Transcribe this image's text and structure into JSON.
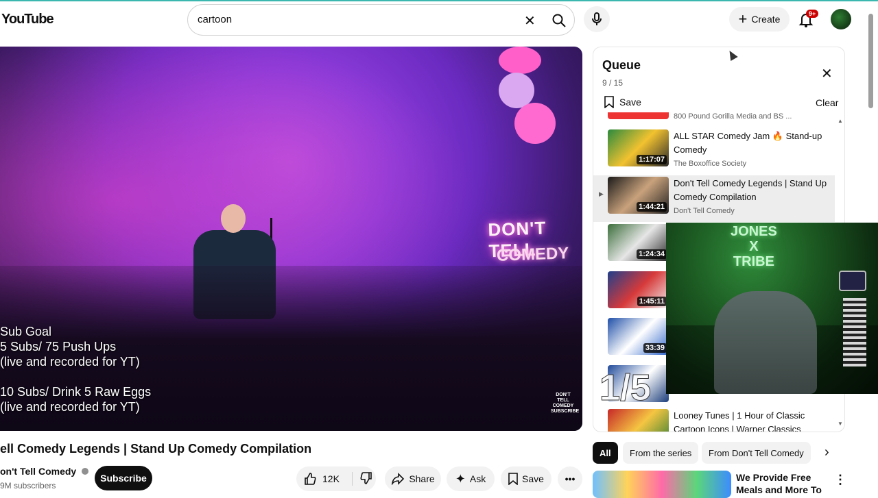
{
  "header": {
    "logo_text": "YouTube",
    "search_value": "cartoon",
    "create_label": "Create",
    "notifications_badge": "9+"
  },
  "player": {
    "overlay_text": "Sub Goal\n5 Subs/ 75 Push Ups\n(live and recorded for YT)\n\n10 Subs/ Drink 5 Raw Eggs\n(live and recorded for YT)",
    "neon_line1": "DON'T TELL",
    "neon_line2": "COMEDY",
    "watermark": "DON'T TELL COMEDY SUBSCRIBE"
  },
  "video": {
    "title": "ell Comedy Legends | Stand Up Comedy Compilation",
    "channel": "on't Tell Comedy",
    "subscribers": "9M subscribers",
    "subscribe_label": "Subscribe",
    "likes": "12K",
    "share_label": "Share",
    "ask_label": "Ask",
    "save_label": "Save"
  },
  "queue": {
    "title": "Queue",
    "count": "9 / 15",
    "save_label": "Save",
    "clear_label": "Clear",
    "partial_channel": "800 Pound Gorilla Media and BS ...",
    "items": [
      {
        "title": "ALL STAR Comedy Jam 🔥 Stand-up Comedy",
        "channel": "The Boxoffice Society",
        "duration": "1:17:07",
        "active": false
      },
      {
        "title": "Don't Tell Comedy Legends | Stand Up Comedy Compilation",
        "channel": "Don't Tell Comedy",
        "duration": "1:44:21",
        "active": true
      },
      {
        "title": "",
        "channel": "",
        "duration": "1:24:34",
        "active": false
      },
      {
        "title": "",
        "channel": "",
        "duration": "1:45:11",
        "active": false
      },
      {
        "title": "",
        "channel": "",
        "duration": "33:39",
        "active": false
      },
      {
        "title": "",
        "channel": "",
        "duration": "",
        "active": false
      },
      {
        "title": "Looney Tunes | 1 Hour of Classic Cartoon Icons | Warner Classics",
        "channel": "",
        "duration": "",
        "active": false
      }
    ]
  },
  "webcam": {
    "neon_text": "JONES\nX\nTRIBE",
    "score_overlay": "1/5"
  },
  "filters": {
    "chips": [
      "All",
      "From the series",
      "From Don't Tell Comedy"
    ]
  },
  "recommendation": {
    "title": "We Provide Free Meals and More To Help Your"
  },
  "colors": {
    "accent_teal": "#3cb7b0",
    "badge_red": "#cc0000"
  }
}
